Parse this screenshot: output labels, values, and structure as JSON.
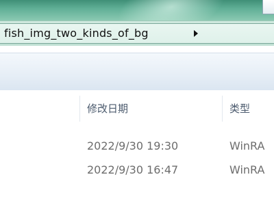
{
  "address": {
    "path": "fish_img_two_kinds_of_bg"
  },
  "columns": {
    "date_modified": "修改日期",
    "type": "类型"
  },
  "rows": [
    {
      "date": "2022/9/30 19:30",
      "type": "WinRA"
    },
    {
      "date": "2022/9/30 16:47",
      "type": "WinRA"
    }
  ]
}
